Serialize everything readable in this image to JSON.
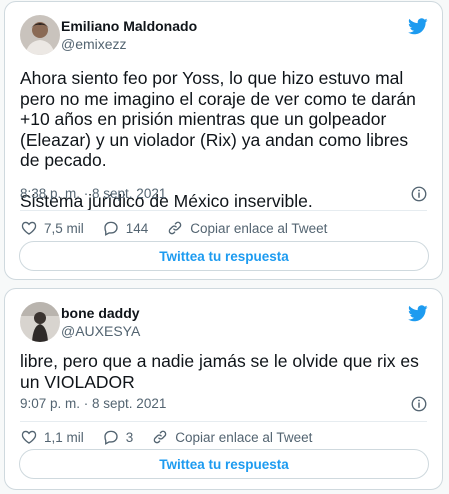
{
  "colors": {
    "accent": "#1d9bf0",
    "text": "#0f1419",
    "muted": "#536471",
    "border": "#cfd9de"
  },
  "tweets": [
    {
      "author_name": "Emiliano Maldonado",
      "handle": "@emixezz",
      "text": "Ahora siento feo por Yoss, lo que hizo estuvo mal pero no me imagino el coraje de ver como te darán +10 años en prisión mientras que un golpeador (Eleazar) y un violador (Rix) ya andan como libres de pecado.\n\nSistema jurídico de México inservible.",
      "timestamp": "8:38 p. m. · 8 sept. 2021",
      "likes": "7,5 mil",
      "replies": "144",
      "copy_link_label": "Copiar enlace al Tweet",
      "reply_button_label": "Twittea tu respuesta",
      "icons": {
        "brand": "twitter-bird-icon",
        "info": "info-icon",
        "like": "heart-icon",
        "reply": "speech-bubble-icon",
        "link": "link-icon"
      }
    },
    {
      "author_name": "bone daddy",
      "handle": "@AUXESYA",
      "text": "libre, pero que a nadie jamás se le olvide que rix es un VIOLADOR",
      "timestamp": "9:07 p. m. · 8 sept. 2021",
      "likes": "1,1 mil",
      "replies": "3",
      "copy_link_label": "Copiar enlace al Tweet",
      "reply_button_label": "Twittea tu respuesta",
      "icons": {
        "brand": "twitter-bird-icon",
        "info": "info-icon",
        "like": "heart-icon",
        "reply": "speech-bubble-icon",
        "link": "link-icon"
      }
    }
  ]
}
